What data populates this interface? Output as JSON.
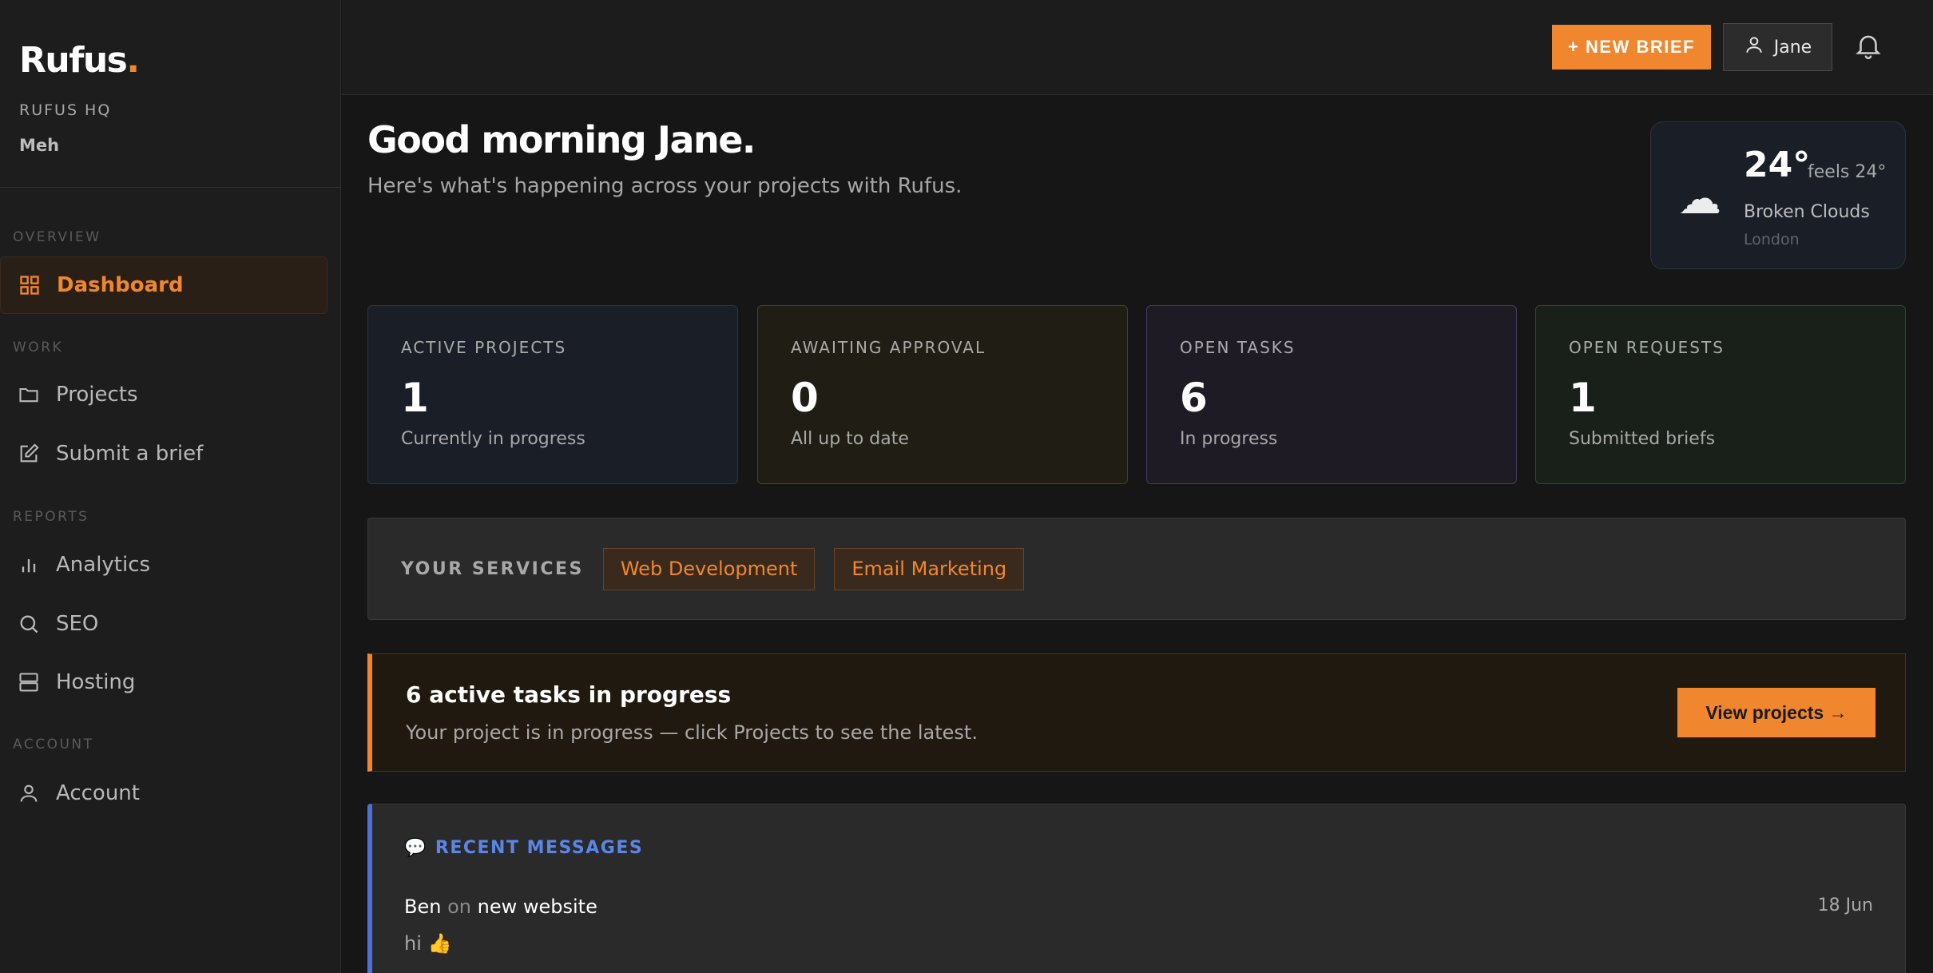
{
  "sidebar": {
    "brand": "Rufus",
    "brand_dot": ".",
    "org": "RUFUS HQ",
    "user_sub": "Meh",
    "sections": {
      "overview": "OVERVIEW",
      "work": "WORK",
      "reports": "REPORTS",
      "account": "ACCOUNT"
    },
    "items": {
      "dashboard": "Dashboard",
      "projects": "Projects",
      "submit_brief": "Submit a brief",
      "analytics": "Analytics",
      "seo": "SEO",
      "hosting": "Hosting",
      "account": "Account"
    }
  },
  "topbar": {
    "new_brief": "+ NEW BRIEF",
    "user_name": "Jane"
  },
  "greeting": {
    "title": "Good morning Jane.",
    "subtitle": "Here's what's happening across your projects with Rufus."
  },
  "weather": {
    "icon": "cloud-icon",
    "temp": "24°",
    "feels": "feels 24°",
    "condition": "Broken Clouds",
    "city": "London"
  },
  "stats": [
    {
      "label": "ACTIVE PROJECTS",
      "value": "1",
      "sub": "Currently in progress"
    },
    {
      "label": "AWAITING APPROVAL",
      "value": "0",
      "sub": "All up to date"
    },
    {
      "label": "OPEN TASKS",
      "value": "6",
      "sub": "In progress"
    },
    {
      "label": "OPEN REQUESTS",
      "value": "1",
      "sub": "Submitted briefs"
    }
  ],
  "services": {
    "label": "YOUR SERVICES",
    "items": [
      "Web Development",
      "Email Marketing"
    ]
  },
  "banner": {
    "title": "6 active tasks in progress",
    "text": "Your project is in progress — click Projects to see the latest.",
    "button": "View projects →"
  },
  "messages": {
    "header": "RECENT MESSAGES",
    "items": [
      {
        "author": "Ben",
        "on": "on",
        "project": "new website",
        "date": "18 Jun",
        "body": "hi 👍"
      }
    ]
  },
  "colors": {
    "accent": "#f0872e",
    "messages_accent": "#4c72d6",
    "background": "#161616",
    "sidebar": "#1d1d1d"
  }
}
